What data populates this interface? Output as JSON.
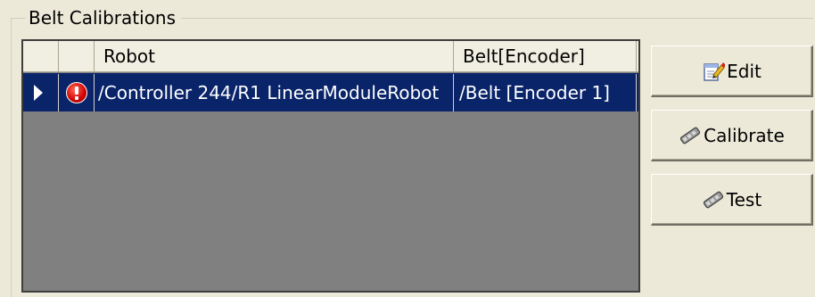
{
  "group": {
    "title": "Belt Calibrations"
  },
  "grid": {
    "columns": [
      "Robot",
      "Belt[Encoder]"
    ],
    "rows": [
      {
        "robot": "/Controller 244/R1 LinearModuleRobot",
        "belt": "/Belt [Encoder 1]",
        "status_icon": "error-icon",
        "selected": true
      }
    ]
  },
  "buttons": {
    "edit_label": "Edit",
    "calibrate_label": "Calibrate",
    "test_label": "Test"
  },
  "colors": {
    "selection": "#0a246a",
    "grid_background": "#808080",
    "window_background": "#ece9d8",
    "error": "#d00000"
  }
}
